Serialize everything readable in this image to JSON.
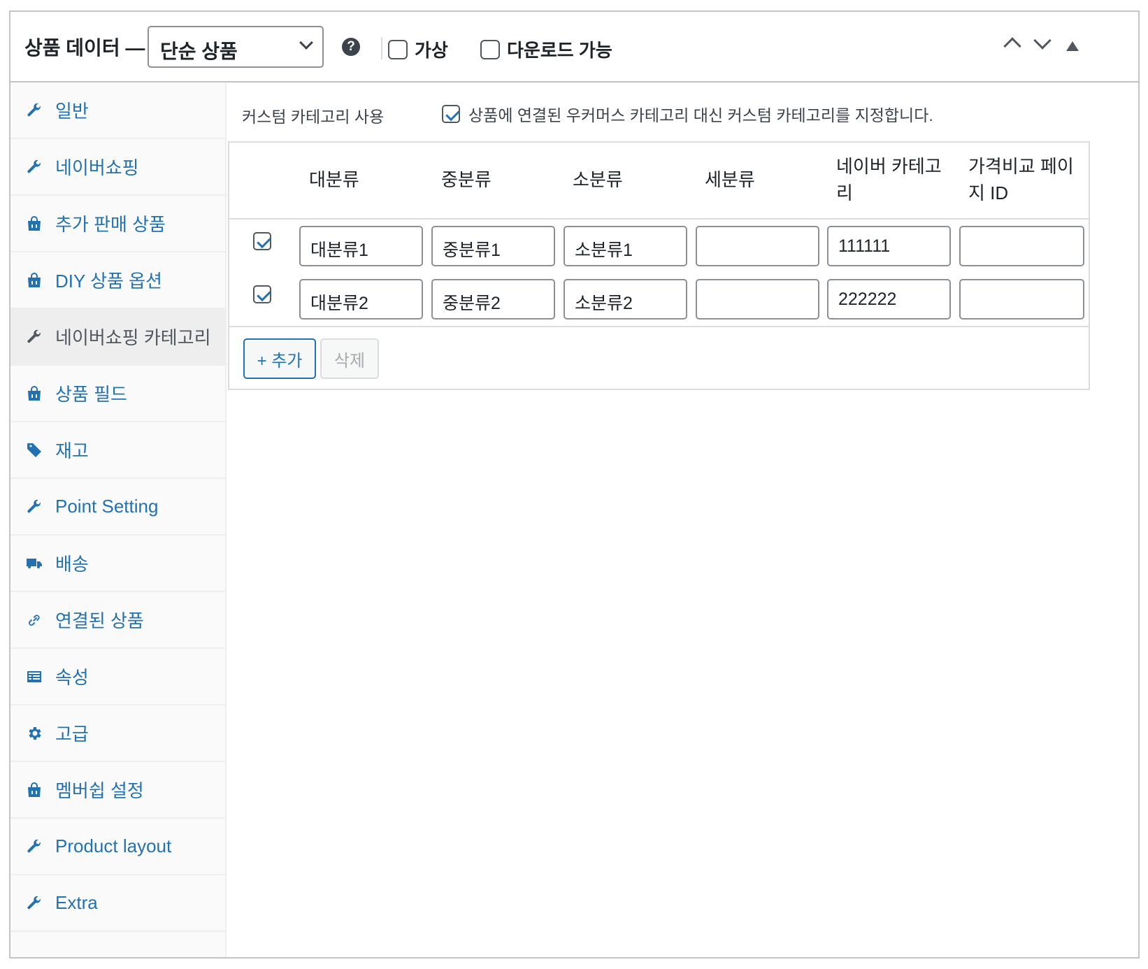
{
  "header": {
    "title": "상품 데이터 —",
    "product_type": "단순 상품",
    "help_icon": "?",
    "virtual_label": "가상",
    "downloadable_label": "다운로드 가능"
  },
  "sidebar": {
    "items": [
      {
        "label": "일반",
        "icon": "wrench-icon"
      },
      {
        "label": "네이버쇼핑",
        "icon": "wrench-icon"
      },
      {
        "label": "추가 판매 상품",
        "icon": "bag-icon"
      },
      {
        "label": "DIY 상품 옵션",
        "icon": "bag-icon"
      },
      {
        "label": "네이버쇼핑 카테고리",
        "icon": "wrench-icon"
      },
      {
        "label": "상품 필드",
        "icon": "bag-icon"
      },
      {
        "label": "재고",
        "icon": "tag-icon"
      },
      {
        "label": "Point Setting",
        "icon": "wrench-icon"
      },
      {
        "label": "배송",
        "icon": "truck-icon"
      },
      {
        "label": "연결된 상품",
        "icon": "link-icon"
      },
      {
        "label": "속성",
        "icon": "list-icon"
      },
      {
        "label": "고급",
        "icon": "gear-icon"
      },
      {
        "label": "멤버쉽 설정",
        "icon": "bag-icon"
      },
      {
        "label": "Product layout",
        "icon": "wrench-icon"
      },
      {
        "label": "Extra",
        "icon": "wrench-icon"
      }
    ],
    "active_index": 4
  },
  "main": {
    "custom_category_label": "커스텀 카테고리 사용",
    "custom_category_desc": "상품에 연결된 우커머스 카테고리 대신 커스텀 카테고리를 지정합니다.",
    "custom_category_checked": true,
    "table": {
      "headers": [
        "대분류",
        "중분류",
        "소분류",
        "세분류",
        "네이버 카테고리",
        "가격비교 페이지 ID"
      ],
      "rows": [
        {
          "checked": true,
          "cells": [
            "대분류1",
            "중분류1",
            "소분류1",
            "",
            "111111",
            ""
          ]
        },
        {
          "checked": true,
          "cells": [
            "대분류2",
            "중분류2",
            "소분류2",
            "",
            "222222",
            ""
          ]
        }
      ]
    },
    "add_button": "+ 추가",
    "delete_button": "삭제"
  },
  "colors": {
    "link": "#2271b1",
    "border": "#c3c4c7",
    "active_bg": "#eeeeee"
  }
}
